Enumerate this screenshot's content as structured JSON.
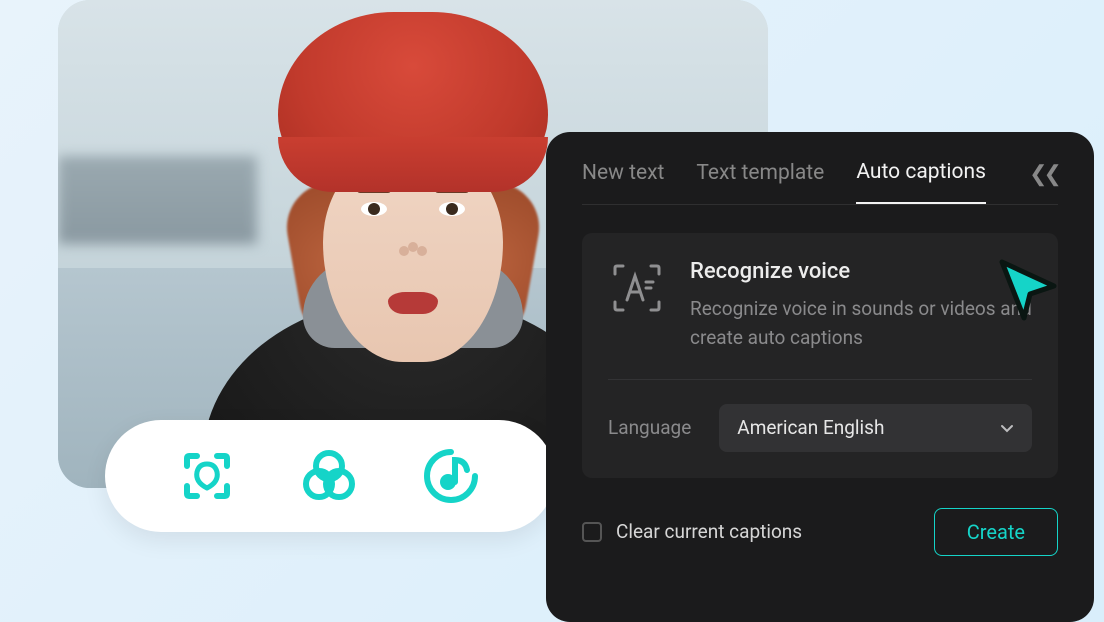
{
  "colors": {
    "accent": "#15d4c8",
    "panel_bg": "#1b1b1c",
    "card_bg": "#242425"
  },
  "dock": {
    "items": [
      {
        "name": "scan-icon"
      },
      {
        "name": "filters-icon"
      },
      {
        "name": "music-icon"
      }
    ]
  },
  "panel": {
    "tabs": [
      {
        "label": "New text",
        "active": false
      },
      {
        "label": "Text template",
        "active": false
      },
      {
        "label": "Auto captions",
        "active": true
      }
    ],
    "card": {
      "title": "Recognize voice",
      "description": "Recognize voice in sounds or videos and create auto captions"
    },
    "language": {
      "label": "Language",
      "selected": "American English"
    },
    "clear": {
      "label": "Clear current captions",
      "checked": false
    },
    "create_label": "Create"
  }
}
